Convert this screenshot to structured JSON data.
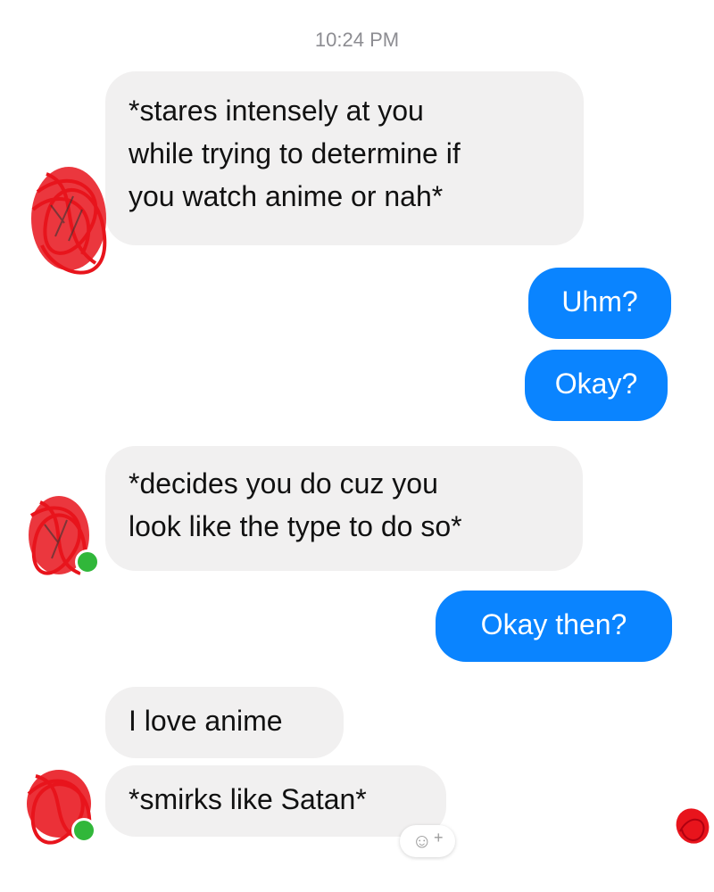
{
  "header": {
    "timestamp": "10:24 PM"
  },
  "messages": [
    {
      "direction": "incoming",
      "lines": [
        "*stares intensely at you",
        "while trying to determine if",
        "you watch anime or nah*"
      ]
    },
    {
      "direction": "outgoing",
      "text": "Uhm?"
    },
    {
      "direction": "outgoing",
      "text": "Okay?"
    },
    {
      "direction": "incoming",
      "lines": [
        "*decides you do cuz you",
        "look like the type to do so*"
      ]
    },
    {
      "direction": "outgoing",
      "text": "Okay then?"
    },
    {
      "direction": "incoming",
      "text": "I love anime"
    },
    {
      "direction": "incoming",
      "text": "*smirks like Satan*"
    }
  ],
  "reaction_button": {
    "icon": "smiley-add-icon",
    "symbol": "☺",
    "plus": "+"
  },
  "colors": {
    "outgoing_bubble": "#0a84ff",
    "incoming_bubble": "#f1f0f0",
    "presence": "#31b73a",
    "scribble": "#e8141c"
  }
}
